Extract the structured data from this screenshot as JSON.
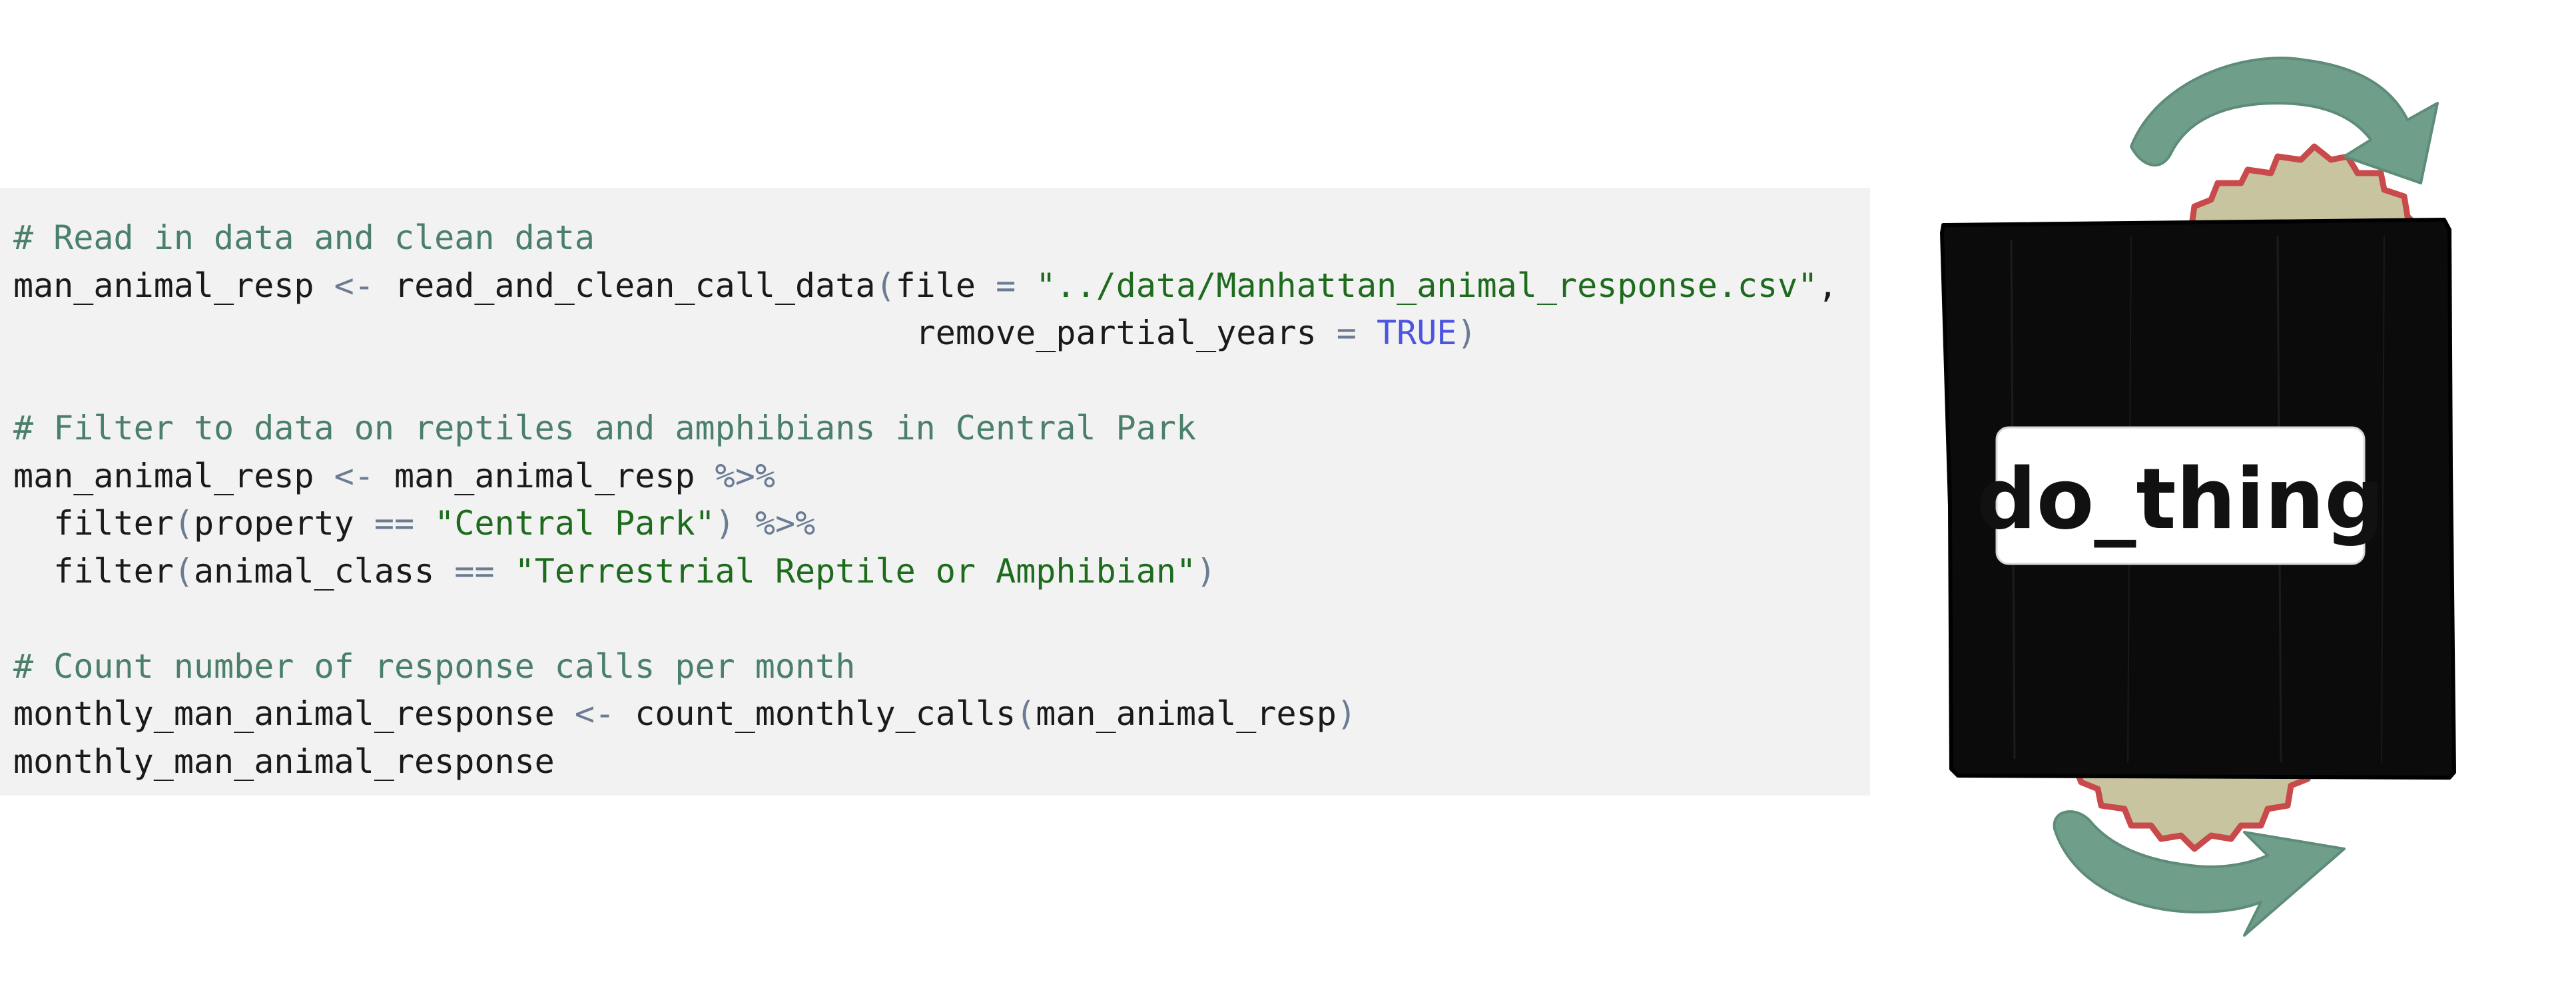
{
  "code": {
    "comment_read": "# Read in data and clean data",
    "var_resp": "man_animal_resp",
    "assign": "<-",
    "fn_read": "read_and_clean_call_data",
    "paren_open": "(",
    "paren_close": ")",
    "arg_file": "file",
    "eq": "=",
    "str_file": "\"../data/Manhattan_animal_response.csv\"",
    "comma": ",",
    "indent_args": "                                             ",
    "arg_remove": "remove_partial_years",
    "kw_true": "TRUE",
    "comment_filter": "# Filter to data on reptiles and amphibians in Central Park",
    "pipe": "%>%",
    "indent_pipe": "  ",
    "fn_filter": "filter",
    "arg_property": "property",
    "eqeq": "==",
    "str_park": "\"Central Park\"",
    "arg_class": "animal_class",
    "str_class": "\"Terrestrial Reptile or Amphibian\"",
    "comment_count": "# Count number of response calls per month",
    "var_monthly": "monthly_man_animal_response",
    "fn_count": "count_monthly_calls"
  },
  "illustration": {
    "label": "do_thing",
    "colors": {
      "box": "#0b0b0b",
      "arrow": "#6f9e8a",
      "gear_fill": "#c8c4a0",
      "gear_edge": "#c84a4a",
      "label_bg": "#ffffff"
    }
  }
}
